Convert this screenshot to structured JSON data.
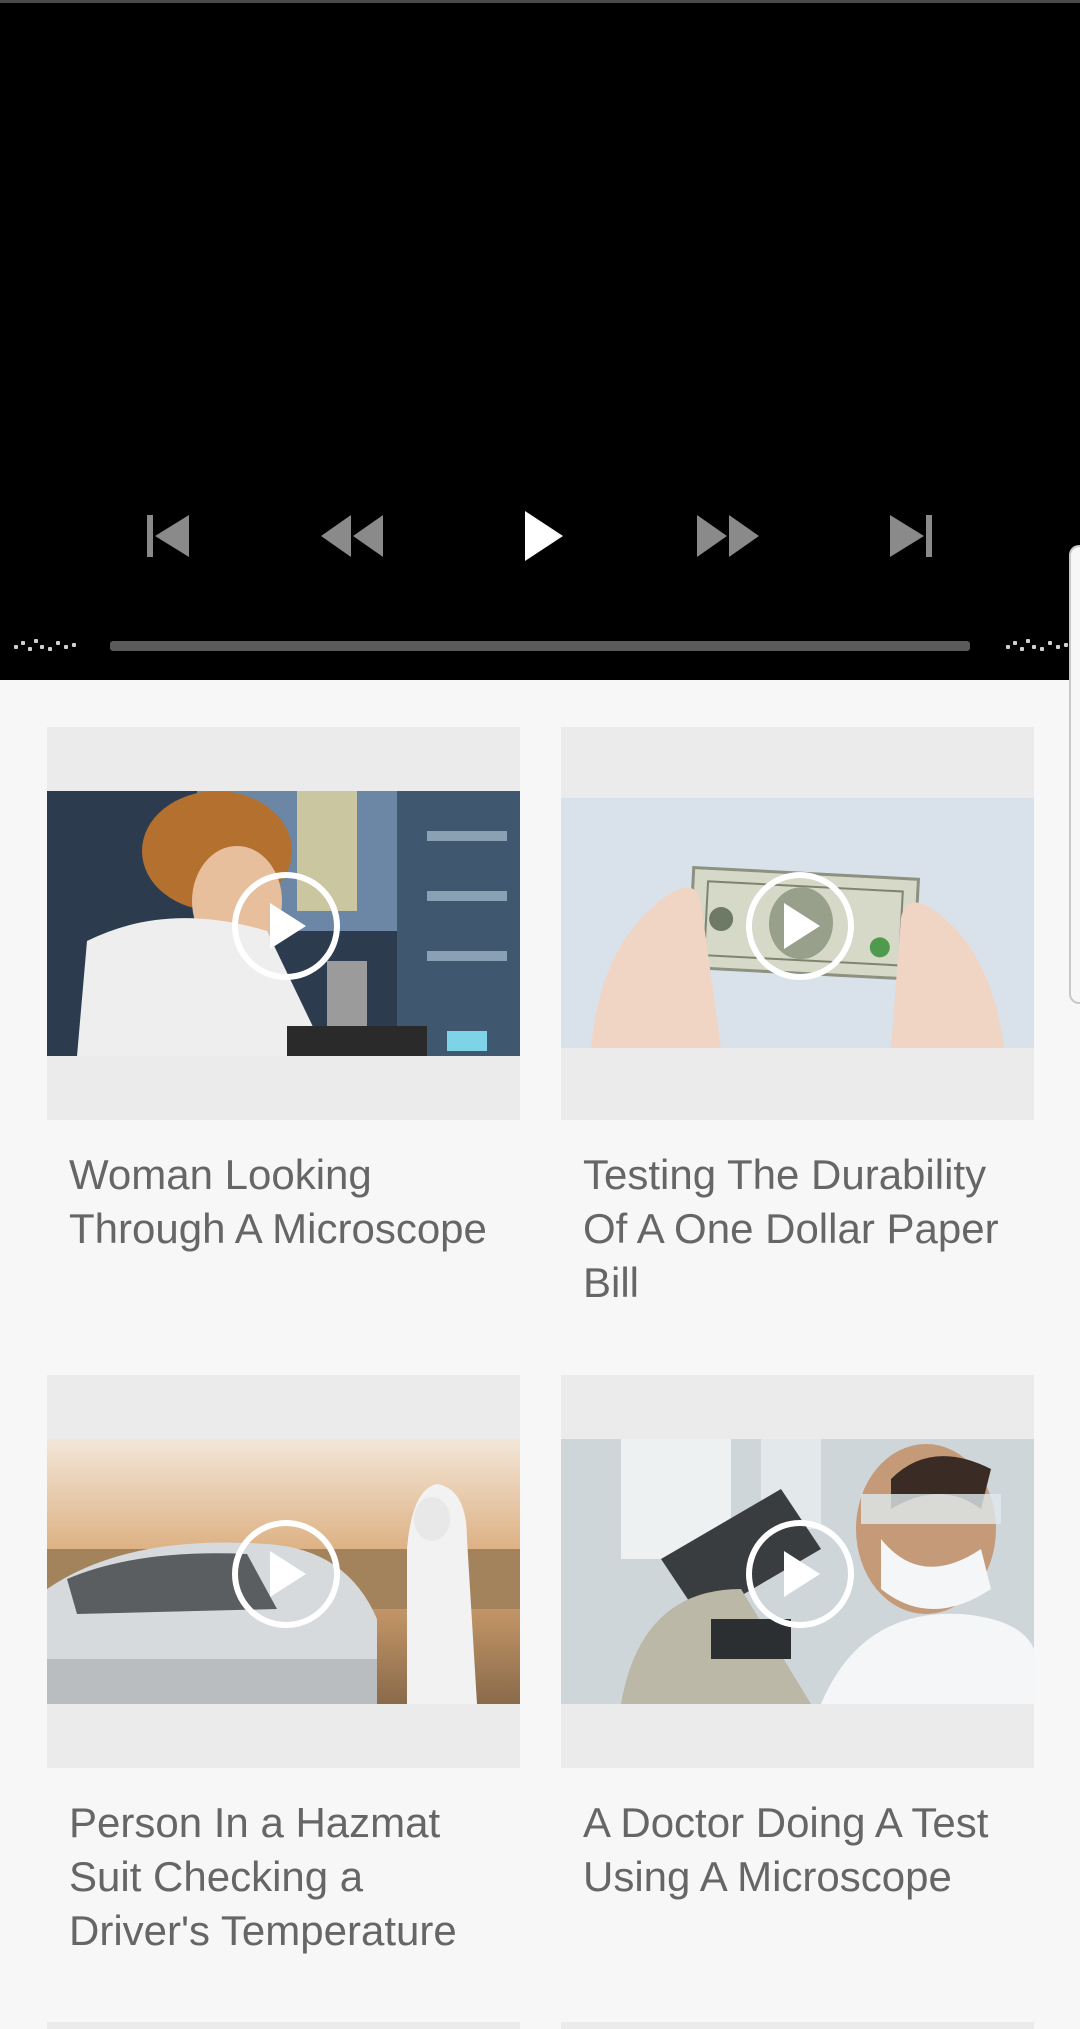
{
  "player": {
    "controls": {
      "skip_previous": "skip-previous-icon",
      "rewind": "rewind-icon",
      "play": "play-icon",
      "fast_forward": "fast-forward-icon",
      "skip_next": "skip-next-icon"
    },
    "progress": 0,
    "elapsed_icon": "time-elapsed-dots",
    "duration_icon": "time-duration-dots"
  },
  "videos": [
    {
      "title": "Woman Looking Through A Microscope"
    },
    {
      "title": "Testing The Durability Of A One Dollar Paper Bill"
    },
    {
      "title": "Person In a Hazmat Suit Checking a Driver's Temperature"
    },
    {
      "title": "A Doctor Doing A Test Using A Microscope"
    }
  ],
  "colors": {
    "player_bg": "#000000",
    "page_bg": "#f7f7f7",
    "card_bg": "#ebebeb",
    "title_text": "#666666",
    "progress_track": "#5a5a5a"
  }
}
